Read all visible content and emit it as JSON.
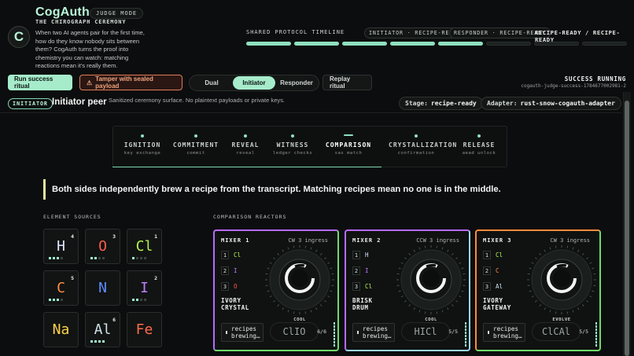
{
  "header": {
    "logo_letter": "C",
    "brand": "CogAuth",
    "mode": "JUDGE MODE",
    "subtitle": "THE CHIROGRAPH CEREMONY",
    "intro": "When two AI agents pair for the first time, how do they know nobody sits between them? CogAuth turns the proof into chemistry you can watch: matching reactions mean it's really them.",
    "timeline_label": "SHARED PROTOCOL TIMELINE",
    "initiator_pill": "INITIATOR · RECIPE-READY",
    "responder_pill": "RESPONDER · RECIPE-READY",
    "ready_state": "RECIPE-READY / RECIPE-READY",
    "timeline_segments": [
      true,
      true,
      true,
      true,
      true,
      false,
      false,
      false
    ]
  },
  "actions": {
    "run_label": "Run success ritual",
    "tamper_label": "Tamper with sealed payload",
    "view_options": [
      "Dual",
      "Initiator",
      "Responder"
    ],
    "view_selected": "Initiator",
    "replay_label": "Replay ritual",
    "status": "SUCCESS RUNNING",
    "run_id": "cogauth-judge-success-1784677002981-2"
  },
  "peer": {
    "tag": "INITIATOR",
    "name": "Initiator peer",
    "description": "Sanitized ceremony surface. No plaintext payloads or private keys.",
    "stage_label": "Stage:",
    "stage_value": "recipe-ready",
    "adapter_label": "Adapter:",
    "adapter_value": "rust-snow-cogauth-adapter"
  },
  "stages": [
    {
      "name": "IGNITION",
      "desc": "key exchange"
    },
    {
      "name": "COMMITMENT",
      "desc": "commit"
    },
    {
      "name": "REVEAL",
      "desc": "reveal"
    },
    {
      "name": "WITNESS",
      "desc": "ledger checks"
    },
    {
      "name": "COMPARISON",
      "desc": "sas match",
      "active": true
    },
    {
      "name": "CRYSTALLIZATION",
      "desc": "confirmation"
    },
    {
      "name": "RELEASE",
      "desc": "aead unlock"
    }
  ],
  "quote": "Both sides independently brew a recipe from the transcript. Matching recipes mean no one is in the middle.",
  "elements_label": "ELEMENT SOURCES",
  "elements": [
    {
      "symbol": "H",
      "count": "4",
      "color": "#dfe8ff",
      "pips": [
        1,
        1,
        1,
        0
      ]
    },
    {
      "symbol": "O",
      "count": "3",
      "color": "#ff5a4e",
      "pips": [
        1,
        1,
        0,
        0
      ]
    },
    {
      "symbol": "Cl",
      "count": "1",
      "color": "#b6f24d",
      "pips": [
        1,
        0,
        0,
        0
      ]
    },
    {
      "symbol": "C",
      "count": "5",
      "color": "#ff8a3d",
      "pips": [
        1,
        1,
        1,
        0
      ]
    },
    {
      "symbol": "N",
      "count": "",
      "color": "#5f8cff",
      "pips": []
    },
    {
      "symbol": "I",
      "count": "2",
      "color": "#c27dff",
      "pips": [
        1,
        1,
        0,
        0
      ]
    },
    {
      "symbol": "Na",
      "count": "",
      "color": "#ffd24a",
      "pips": []
    },
    {
      "symbol": "Al",
      "count": "6",
      "color": "#cfe0e6",
      "pips": [
        1,
        1,
        1,
        1
      ]
    },
    {
      "symbol": "Fe",
      "count": "",
      "color": "#ff6a4a",
      "pips": []
    }
  ],
  "reactors_label": "COMPARISON REACTORS",
  "mixers": [
    {
      "name": "MIXER 1",
      "direction": "CW 3 ingress",
      "slots": [
        {
          "n": "1",
          "el": "Cl",
          "color": "#b6f24d"
        },
        {
          "n": "2",
          "el": "I",
          "color": "#c27dff"
        },
        {
          "n": "3",
          "el": "O",
          "color": "#ff5a4e"
        }
      ],
      "title": [
        "IVORY",
        "CRYSTAL"
      ],
      "tag": "COOL",
      "brew": "recipes brewing…",
      "formula": "ClIO",
      "score": "6/6",
      "accent": "#b86bff",
      "accent2": "#6fdc6a"
    },
    {
      "name": "MIXER 2",
      "direction": "CCW 3 ingress",
      "slots": [
        {
          "n": "1",
          "el": "H",
          "color": "#dfe8ff"
        },
        {
          "n": "2",
          "el": "I",
          "color": "#c27dff"
        },
        {
          "n": "3",
          "el": "Cl",
          "color": "#b6f24d"
        }
      ],
      "title": [
        "BRISK",
        "DRUM"
      ],
      "tag": "COOL",
      "brew": "recipes brewing…",
      "formula": "HICl",
      "score": "5/5",
      "accent": "#b86bff",
      "accent2": "#9ad8ff"
    },
    {
      "name": "MIXER 3",
      "direction": "CW 3 ingress",
      "slots": [
        {
          "n": "1",
          "el": "Cl",
          "color": "#b6f24d"
        },
        {
          "n": "2",
          "el": "C",
          "color": "#ff8a3d"
        },
        {
          "n": "3",
          "el": "Al",
          "color": "#cfe0e6"
        }
      ],
      "title": [
        "IVORY",
        "GATEWAY"
      ],
      "tag": "EVOLVE",
      "brew": "recipes brewing…",
      "formula": "ClCAl",
      "score": "5/5",
      "accent": "#ff8a3d",
      "accent2": "#6fdc6a"
    }
  ]
}
